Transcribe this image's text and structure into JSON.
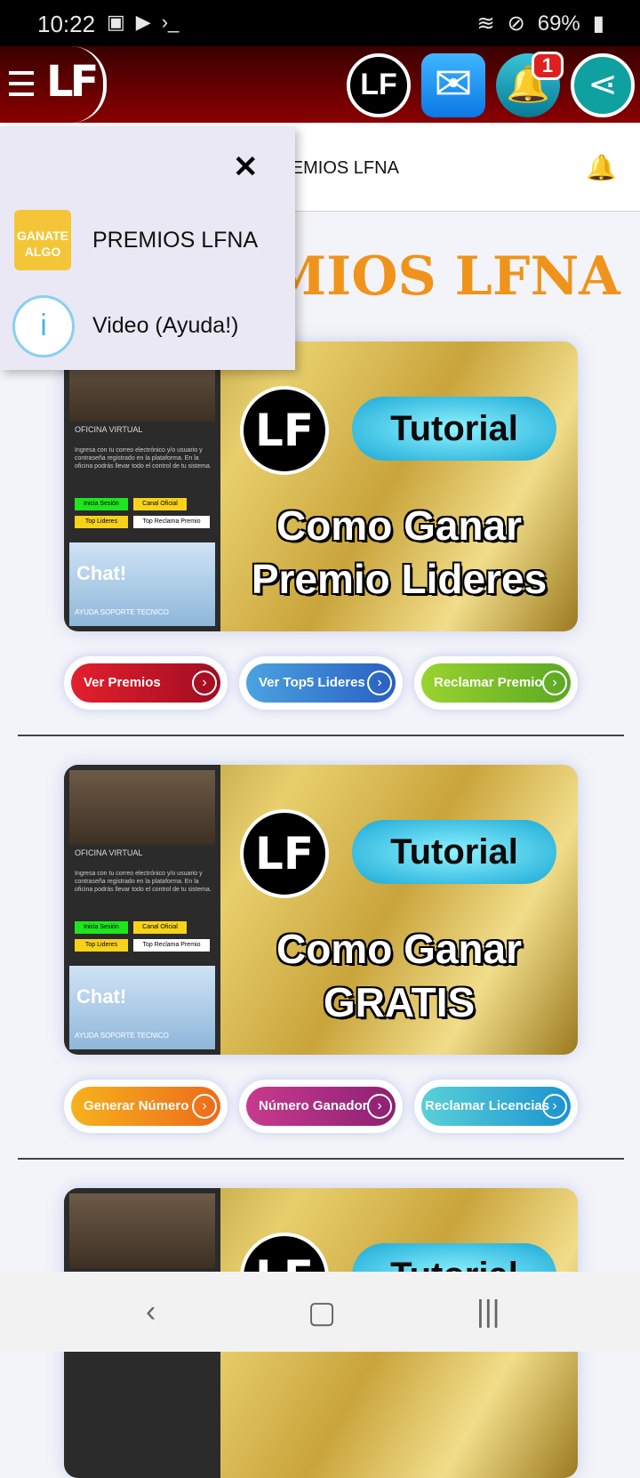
{
  "status": {
    "time": "10:22",
    "battery": "69%"
  },
  "appbar": {
    "notification_count": "1"
  },
  "header": {
    "title": "PREMIOS LFNA",
    "big_title": "PREMIOS LFNA"
  },
  "drawer": {
    "items": [
      {
        "label": "PREMIOS LFNA",
        "icon": "gift-icon",
        "icon_text": "GANATE ALGO"
      },
      {
        "label": "Video (Ayuda!)",
        "icon": "info-icon",
        "icon_text": "i"
      }
    ]
  },
  "cards": [
    {
      "badge": "Tutorial",
      "line1": "Como Ganar",
      "line2": "Premio Lideres",
      "panel": {
        "title": "OFICINA VIRTUAL",
        "desc": "Ingresa con tu correo electrónico y/o usuario y contraseña registrado en la plataforma. En la oficina podrás llevar todo el control de tu sistema.",
        "b1": "Inicia Sesión",
        "b2": "Canal Oficial",
        "b3": "Top Lideres",
        "b4": "Top Reclama Premio",
        "chat": "Chat!",
        "support": "AYUDA SOPORTE TECNICO"
      },
      "buttons": [
        {
          "label": "Ver Premios",
          "color": "#c8102e"
        },
        {
          "label": "Ver Top5 Lideres",
          "color": "#2e72c8"
        },
        {
          "label": "Reclamar Premio",
          "color": "#7cc229"
        }
      ]
    },
    {
      "badge": "Tutorial",
      "line1": "Como Ganar",
      "line2": "GRATIS",
      "panel": {
        "title": "OFICINA VIRTUAL",
        "desc": "Ingresa con tu correo electrónico y/o usuario y contraseña registrado en la plataforma. En la oficina podrás llevar todo el control de tu sistema.",
        "b1": "Inicia Sesión",
        "b2": "Canal Oficial",
        "b3": "Top Lideres",
        "b4": "Top Reclama Premio",
        "chat": "Chat!",
        "support": "AYUDA SOPORTE TECNICO"
      },
      "buttons": [
        {
          "label": "Generar Número",
          "color": "#f08a1c"
        },
        {
          "label": "Número Ganador",
          "color": "#b0307f"
        },
        {
          "label": "Reclamar Licencias",
          "color": "#22a9cf"
        }
      ]
    },
    {
      "badge": "Tutorial"
    }
  ]
}
